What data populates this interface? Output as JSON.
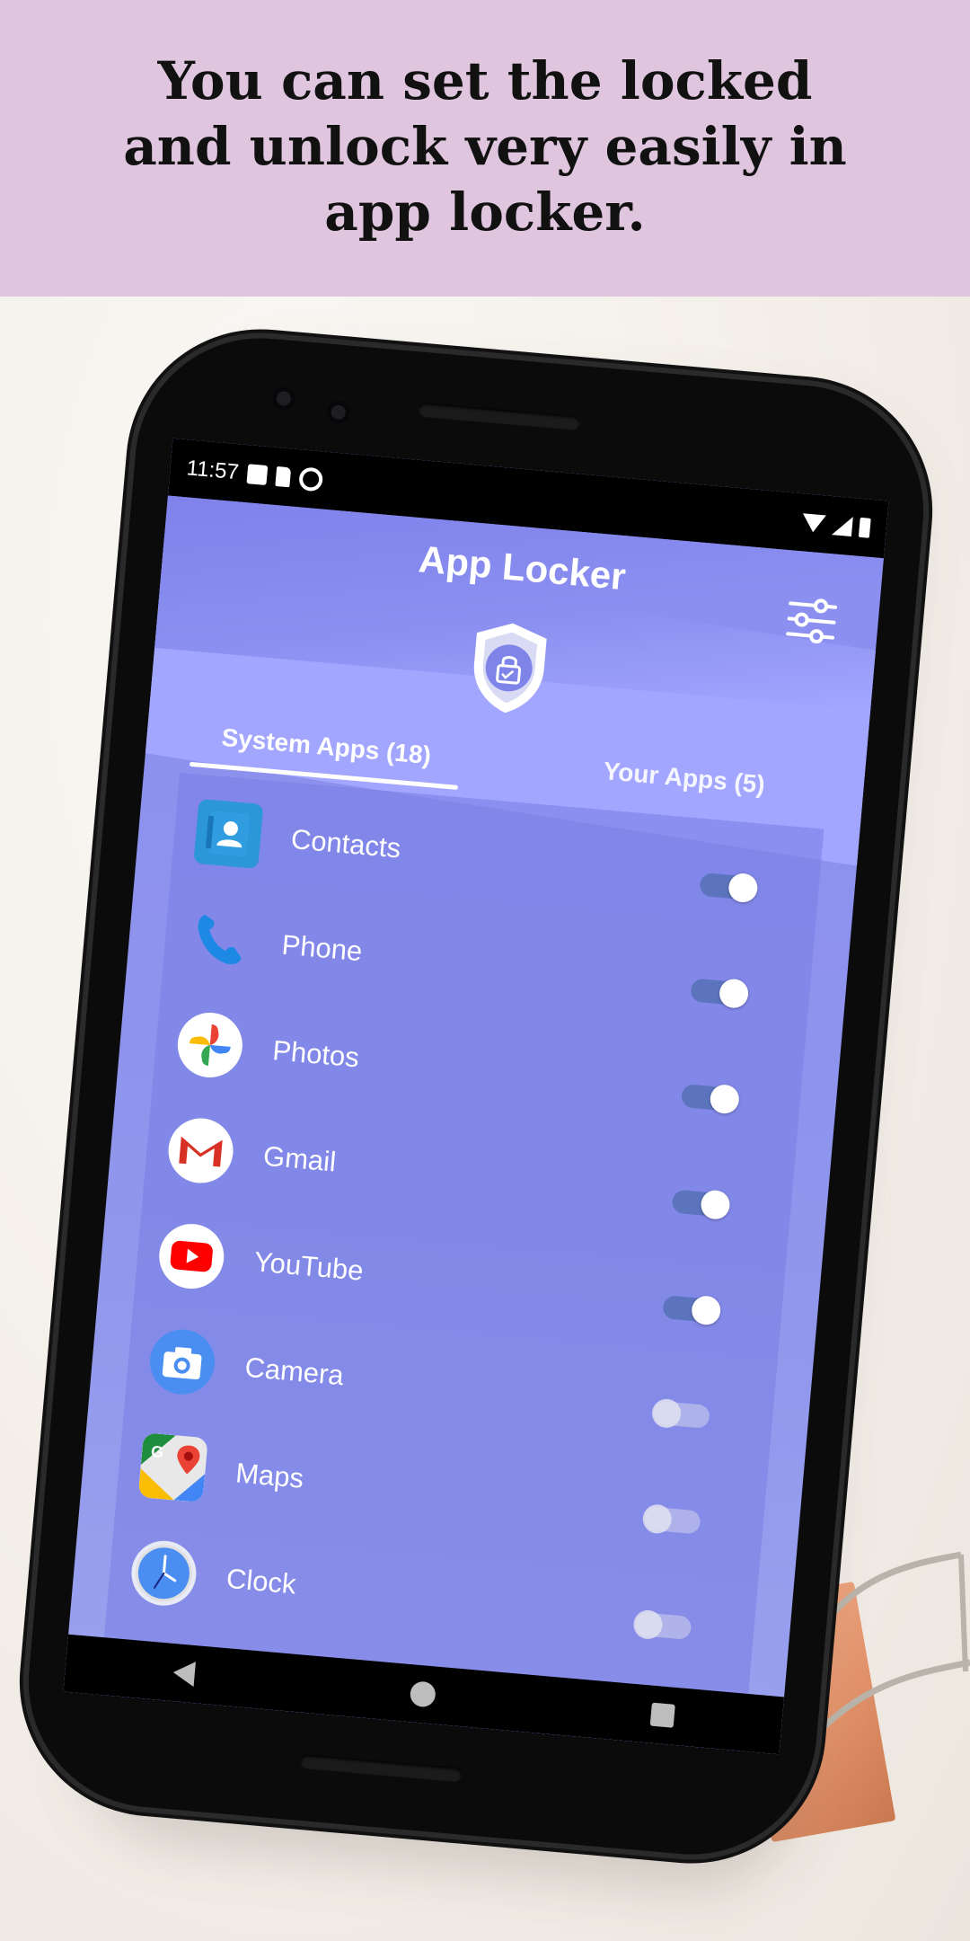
{
  "banner": {
    "headline": "You can set the locked and unlock very easily in app locker."
  },
  "statusbar": {
    "time": "11:57",
    "left_icons": [
      "notification-square-icon",
      "sdcard-icon",
      "sync-ring-icon"
    ],
    "right_icons": [
      "wifi-icon",
      "signal-icon",
      "battery-icon"
    ]
  },
  "app": {
    "title": "App Locker",
    "settings_icon": "sliders-icon",
    "logo_icon": "shield-lock-icon",
    "accent_color": "#8b8df0"
  },
  "tabs": [
    {
      "label": "System Apps (18)",
      "active": true
    },
    {
      "label": "Your Apps (5)",
      "active": false
    }
  ],
  "apps": [
    {
      "name": "Contacts",
      "icon": "contacts-icon",
      "locked": true
    },
    {
      "name": "Phone",
      "icon": "phone-icon",
      "locked": true
    },
    {
      "name": "Photos",
      "icon": "photos-icon",
      "locked": true
    },
    {
      "name": "Gmail",
      "icon": "gmail-icon",
      "locked": true
    },
    {
      "name": "YouTube",
      "icon": "youtube-icon",
      "locked": true
    },
    {
      "name": "Camera",
      "icon": "camera-icon",
      "locked": false
    },
    {
      "name": "Maps",
      "icon": "maps-icon",
      "locked": false
    },
    {
      "name": "Clock",
      "icon": "clock-icon",
      "locked": false
    }
  ],
  "navbar": {
    "icons": [
      "back-icon",
      "home-icon",
      "recents-icon"
    ]
  }
}
